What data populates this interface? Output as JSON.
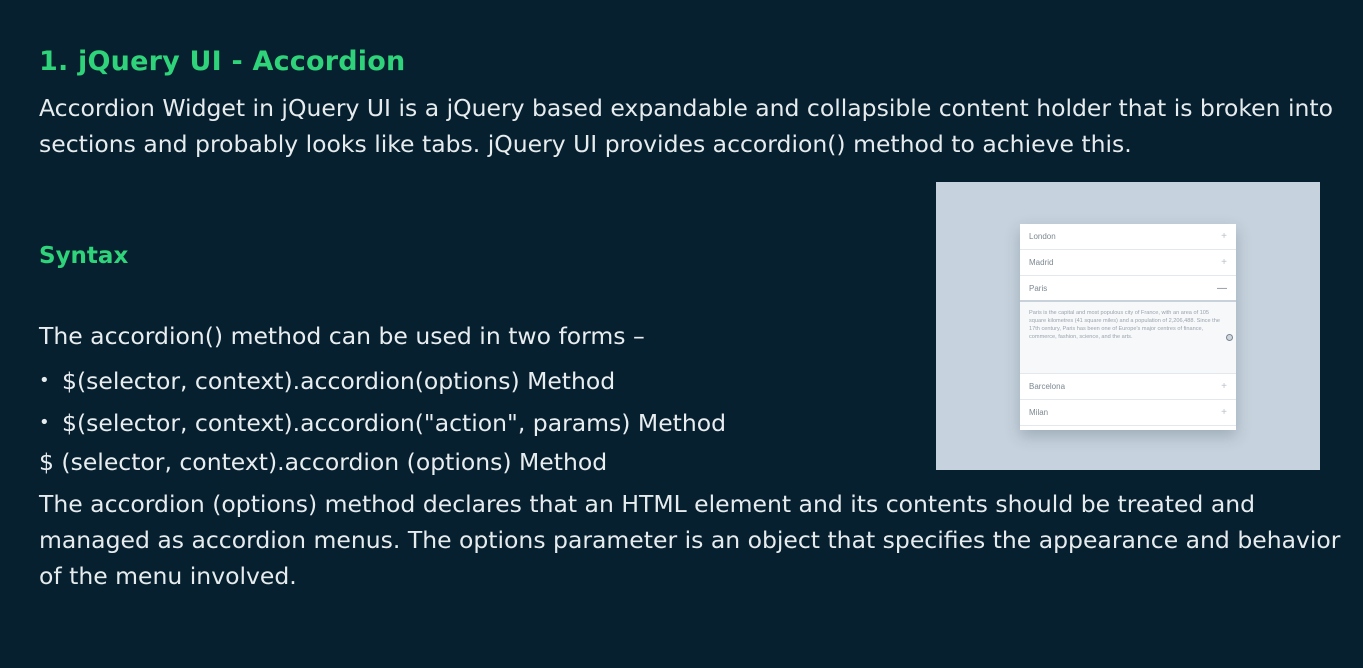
{
  "slide": {
    "title": "1. jQuery UI - Accordion",
    "intro": "Accordion Widget in jQuery UI is a jQuery based expandable and collapsible content holder that is broken into sections and probably looks like tabs.  jQuery UI provides accordion() method to achieve this.",
    "syntax_heading": "Syntax",
    "forms_lead": "The accordion() method can be used in two forms –",
    "bullet_glyph": "•",
    "bullets": [
      "$(selector, context).accordion(options) Method",
      "$(selector, context).accordion(\"action\", params) Method"
    ],
    "method_heading": "$ (selector, context).accordion (options) Method",
    "description": "The accordion (options) method declares that an HTML element and its contents should be treated and managed as accordion menus. The options parameter is an object that specifies the appearance and behavior of the menu involved."
  },
  "illustration": {
    "rows": [
      {
        "label": "London",
        "sign": "+"
      },
      {
        "label": "Madrid",
        "sign": "+"
      },
      {
        "label": "Paris",
        "sign": "—"
      }
    ],
    "panel_text": "Paris is the capital and most populous city of France, with an area of 105 square kilometres (41 square miles) and a population of 2,206,488. Since the 17th century, Paris has been one of Europe's major centres of finance, commerce, fashion, science, and the arts.",
    "rows_after": [
      {
        "label": "Barcelona",
        "sign": "+"
      },
      {
        "label": "Milan",
        "sign": "+"
      }
    ]
  },
  "colors": {
    "background": "#06202f",
    "heading": "#2fd37a",
    "text": "#e6ebee"
  }
}
